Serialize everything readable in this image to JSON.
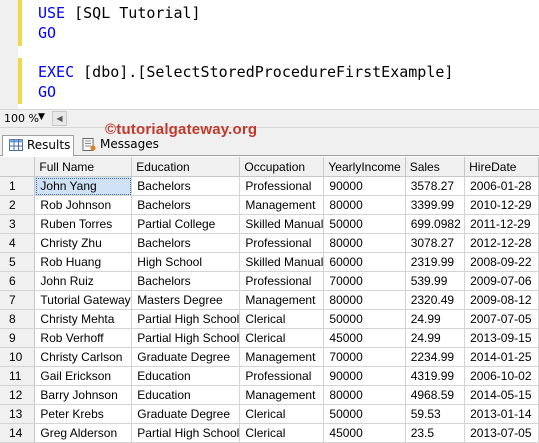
{
  "editor": {
    "line1": {
      "kw": "USE",
      "rest": " [SQL Tutorial]"
    },
    "line2": {
      "kw": "GO"
    },
    "line3": {
      "kw": "EXEC",
      "rest": " [dbo].[SelectStoredProcedureFirstExample]"
    },
    "line4": {
      "kw": "GO"
    }
  },
  "zoom": {
    "value": "100 %"
  },
  "tabs": {
    "results": "Results",
    "messages": "Messages"
  },
  "watermark": "©tutorialgateway.org",
  "table": {
    "columns": [
      "Full Name",
      "Education",
      "Occupation",
      "YearlyIncome",
      "Sales",
      "HireDate"
    ],
    "rows": [
      [
        "1",
        "John Yang",
        "Bachelors",
        "Professional",
        "90000",
        "3578.27",
        "2006-01-28"
      ],
      [
        "2",
        "Rob Johnson",
        "Bachelors",
        "Management",
        "80000",
        "3399.99",
        "2010-12-29"
      ],
      [
        "3",
        "Ruben Torres",
        "Partial College",
        "Skilled Manual",
        "50000",
        "699.0982",
        "2011-12-29"
      ],
      [
        "4",
        "Christy Zhu",
        "Bachelors",
        "Professional",
        "80000",
        "3078.27",
        "2012-12-28"
      ],
      [
        "5",
        "Rob Huang",
        "High School",
        "Skilled Manual",
        "60000",
        "2319.99",
        "2008-09-22"
      ],
      [
        "6",
        "John Ruiz",
        "Bachelors",
        "Professional",
        "70000",
        "539.99",
        "2009-07-06"
      ],
      [
        "7",
        "Tutorial Gateway",
        "Masters Degree",
        "Management",
        "80000",
        "2320.49",
        "2009-08-12"
      ],
      [
        "8",
        "Christy Mehta",
        "Partial High School",
        "Clerical",
        "50000",
        "24.99",
        "2007-07-05"
      ],
      [
        "9",
        "Rob Verhoff",
        "Partial High School",
        "Clerical",
        "45000",
        "24.99",
        "2013-09-15"
      ],
      [
        "10",
        "Christy Carlson",
        "Graduate Degree",
        "Management",
        "70000",
        "2234.99",
        "2014-01-25"
      ],
      [
        "11",
        "Gail Erickson",
        "Education",
        "Professional",
        "90000",
        "4319.99",
        "2006-10-02"
      ],
      [
        "12",
        "Barry Johnson",
        "Education",
        "Management",
        "80000",
        "4968.59",
        "2014-05-15"
      ],
      [
        "13",
        "Peter Krebs",
        "Graduate Degree",
        "Clerical",
        "50000",
        "59.53",
        "2013-01-14"
      ],
      [
        "14",
        "Greg Alderson",
        "Partial High School",
        "Clerical",
        "45000",
        "23.5",
        "2013-07-05"
      ]
    ]
  }
}
